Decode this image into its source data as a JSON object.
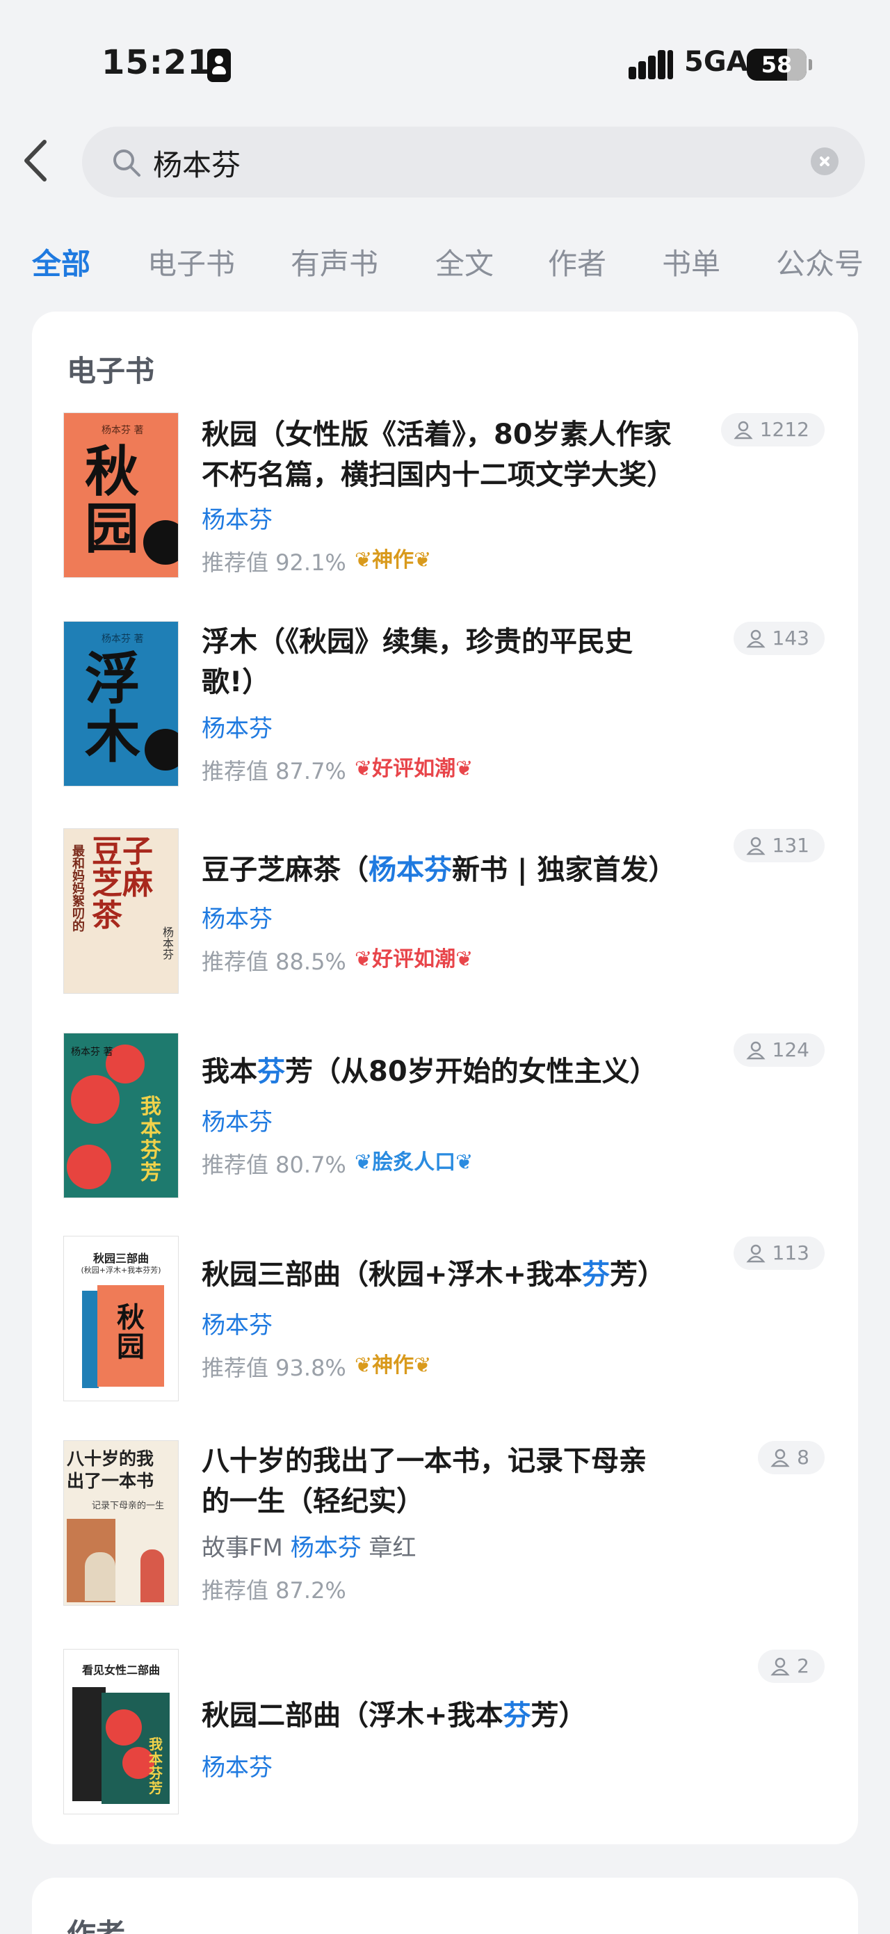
{
  "status": {
    "time": "15:21",
    "network": "5GA",
    "battery": "58"
  },
  "search": {
    "query": "杨本芬"
  },
  "tabs": [
    "全部",
    "电子书",
    "有声书",
    "全文",
    "作者",
    "书单",
    "公众号"
  ],
  "section_ebooks": "电子书",
  "section_authors": "作者",
  "books": [
    {
      "title_line1": "秋园（女性版《活着》，80岁素人作家",
      "title_line2": "不朽名篇，横扫国内十二项文学大奖）",
      "author": "杨本芬",
      "rating": "推荐值 92.1%",
      "badge": "神作",
      "readers": "1212",
      "cover_title": "秋园",
      "cover_author": "杨本芬 著"
    },
    {
      "title_line1": "浮木（《秋园》续集，珍贵的平民史",
      "title_line2": "歌!）",
      "author": "杨本芬",
      "rating": "推荐值 87.7%",
      "badge": "好评如潮",
      "readers": "143",
      "cover_title": "浮木",
      "cover_author": "杨本芬 著"
    },
    {
      "title_pre": "豆子芝麻茶（",
      "title_hl": "杨本芬",
      "title_post": "新书 | 独家首发）",
      "author": "杨本芬",
      "rating": "推荐值 88.5%",
      "badge": "好评如潮",
      "readers": "131",
      "cover_title": "豆子芝麻茶",
      "cover_side": "最和妈妈絮叨的",
      "cover_author": "杨本芬"
    },
    {
      "title_pre": "我本",
      "title_hl": "芬",
      "title_post": "芳（从80岁开始的女性主义）",
      "author": "杨本芬",
      "rating": "推荐值 80.7%",
      "badge": "脍炙人口",
      "readers": "124",
      "cover_title": "我本芬芳",
      "cover_author": "杨本芬 著"
    },
    {
      "title_pre": "秋园三部曲（秋园+浮木+我本",
      "title_hl": "芬",
      "title_post": "芳）",
      "author": "杨本芬",
      "rating": "推荐值 93.8%",
      "badge": "神作",
      "readers": "113",
      "cover_title": "秋园",
      "cover_top1": "秋园三部曲",
      "cover_top2": "(秋园+浮木+我本芬芳)"
    },
    {
      "title_line1": "八十岁的我出了一本书，记录下母亲",
      "title_line2": "的一生（轻纪实）",
      "author_pre": "故事FM",
      "author": "杨本芬",
      "author_post": "章红",
      "rating": "推荐值 87.2%",
      "readers": "8",
      "cover_title1": "八十岁的我",
      "cover_title2": "出了一本书",
      "cover_sub": "记录下母亲的一生"
    },
    {
      "title_pre": "秋园二部曲（浮木+我本",
      "title_hl": "芬",
      "title_post": "芳）",
      "author": "杨本芬",
      "readers": "2",
      "cover_top": "看见女性二部曲",
      "cover_title": "我本芬芳"
    }
  ],
  "colors": {
    "accent": "#1f7ae0",
    "badge_gold": "#d99a1c",
    "badge_red": "#e8454a",
    "badge_blue": "#2a8be0"
  }
}
